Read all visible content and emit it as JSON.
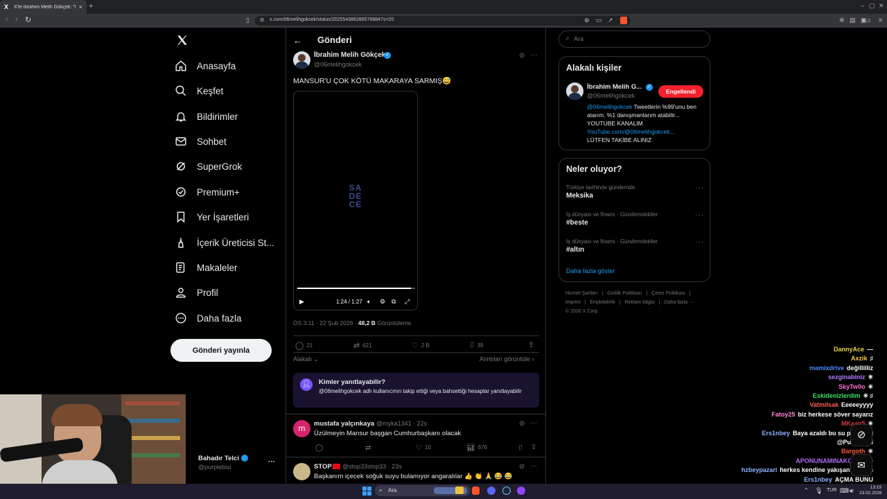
{
  "browser": {
    "tab_title": "X'te İbrahim Melih Gökçek: \"MA",
    "tab_close": "×",
    "new_tab": "+",
    "url": "x.com/06melihgokcek/status/2025543862865768847s=20",
    "win_min": "–",
    "win_max": "▢",
    "win_close": "✕"
  },
  "sidebar": {
    "items": [
      {
        "label": "Anasayfa"
      },
      {
        "label": "Keşfet"
      },
      {
        "label": "Bildirimler"
      },
      {
        "label": "Sohbet"
      },
      {
        "label": "SuperGrok"
      },
      {
        "label": "Premium+"
      },
      {
        "label": "Yer İşaretleri"
      },
      {
        "label": "İçerik Üreticisi St..."
      },
      {
        "label": "Makaleler"
      },
      {
        "label": "Profil"
      },
      {
        "label": "Daha fazla"
      }
    ],
    "post_button": "Gönderi yayınla",
    "account": {
      "name": "Bahadır Telci",
      "handle": "@purplebixi",
      "menu": "···"
    }
  },
  "post": {
    "header": "Gönderi",
    "author": "İbrahim Melih Gökçek",
    "handle": "@06melihgokcek",
    "more": "···",
    "text": "MANSUR'U ÇOK KÖTÜ MAKARAYA SARMIŞ😅",
    "video_time": "1:24 / 1:27",
    "video_progress": 0.963,
    "video_text": "SADECE",
    "timestamp": "ÖS 3:11 · 22 Şub 2026 · ",
    "views": "48,2 B",
    "views_label": " Görüntüleme",
    "replies": "21",
    "reposts": "621",
    "likes": "2 B",
    "bookmarks": "39",
    "related": "Alakalı",
    "quotes_link": "Alıntıları görüntüle",
    "reply_box": {
      "title": "Kimler yanıtlayabilir?",
      "text": "@06melihgokcek adlı kullanıcının takip ettiği veya bahsettiği hesaplar yanıtlayabilir"
    }
  },
  "replies": [
    {
      "avatar": "m",
      "name": "mustafa yalçınkaya",
      "handle": "@myka1341 · 22s",
      "text": "Üzülmeyin Mansur başgan Cumhurbaşkanı olacak",
      "likes": "10",
      "views": "676"
    },
    {
      "name": "STOP",
      "handle": "@stop33stop33 · 23s",
      "text": "Başkanım içecek soğuk suyu bulamıyor angaralılar 👍 👏 🙏 😂 😂"
    }
  ],
  "right": {
    "search_placeholder": "Ara",
    "related_title": "Alakalı kişiler",
    "person": {
      "name": "İbrahim Melih G...",
      "handle": "@06melihgokcek",
      "button": "Engellendi",
      "bio_handle": "@06melihgokcek",
      "bio_1": " Tweetlerin %99'unu ben atarım. %1 danışmanlarım atabilir... YOUTUBE KANALIM",
      "bio_link": "YouTube.com/@06melihgokcek...",
      "bio_2": "LÜTFEN TAKİBE ALINIZ"
    },
    "trends_title": "Neler oluyor?",
    "trends": [
      {
        "meta": "Türkiye tarihinde gündemde",
        "name": "Meksika"
      },
      {
        "meta": "İş dünyası ve finans · Gündemdekiler",
        "name": "#beste"
      },
      {
        "meta": "İş dünyası ve finans · Gündemdekiler",
        "name": "#altın"
      }
    ],
    "show_more": "Daha fazla göster",
    "footer": {
      "line1": [
        "Hizmet Şartları",
        "Gizlilik Politikası",
        "Çerez Politikası"
      ],
      "line2": [
        "Imprint",
        "Erişilebilirlik",
        "Reklam bilgisi",
        "Daha fazla ···"
      ],
      "copyright": "© 2026 X Corp."
    }
  },
  "chat": [
    {
      "user": "DannyAce",
      "msg": "—",
      "color": "#e8d44d"
    },
    {
      "user": "Axzik",
      "msg": "♯",
      "color": "#f2c94c"
    },
    {
      "user": "mamixdrive",
      "msg": "değillilliz",
      "color": "#4a8cff"
    },
    {
      "user": "sezginabiniz",
      "msg": "✳",
      "color": "#b57bff"
    },
    {
      "user": "SkyTw0o",
      "msg": "✳",
      "color": "#ff6fd8"
    },
    {
      "user": "Eskidenizlerdim",
      "msg": "✳ ♯",
      "color": "#3ee06b"
    },
    {
      "user": "Vatmilsak",
      "msg": "Eeeeeyyyy",
      "color": "#ff5b5b"
    },
    {
      "user": "Fatoy25",
      "msg": "biz herkese söver sayarız",
      "color": "#ff8ad8"
    },
    {
      "user": "MKaan5",
      "msg": "✳",
      "color": "#d43a3a"
    },
    {
      "user": "Ers1nbey",
      "msg": "Baya azaldı bu su problemi",
      "color": "#8ab4ff"
    },
    {
      "user": "",
      "msg": "@Purplebixi",
      "color": "#ffffff"
    },
    {
      "user": "Bargoth",
      "msg": "✳",
      "color": "#ff5a3c"
    },
    {
      "user": "APONUNAMINAKOYAN",
      "msg": "✳",
      "color": "#b86bff"
    },
    {
      "user": "hzbeypazari",
      "msg": "herkes kendine yakışanı yapsın",
      "color": "#8ab4ff"
    },
    {
      "user": "Ers1nbey",
      "msg": "AÇMA BUNU",
      "color": "#8ab4ff"
    },
    {
      "user": "Anubi41",
      "msg": "✳",
      "color": "#3ee06b"
    }
  ],
  "taskbar": {
    "search": "Ara",
    "lang": "TUR",
    "time": "13:19",
    "date": "23.02.2026"
  }
}
